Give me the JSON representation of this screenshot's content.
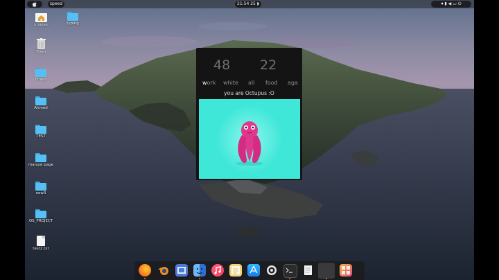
{
  "topbar": {
    "apple_icon": "apple-icon",
    "active_app": "speed",
    "clock": "21:54",
    "indicator": "25"
  },
  "desktop_icons": [
    {
      "label": "ursules",
      "icon": "home-folder-icon"
    },
    {
      "label": "typing",
      "icon": "folder-icon"
    },
    {
      "label": "Trash",
      "icon": "trash-icon"
    },
    {
      "label": "chaos",
      "icon": "folder-icon"
    },
    {
      "label": "Ahmed",
      "icon": "folder-icon"
    },
    {
      "label": "TEST",
      "icon": "folder-icon"
    },
    {
      "label": "manual page",
      "icon": "folder-icon"
    },
    {
      "label": "new3",
      "icon": "folder-icon"
    },
    {
      "label": "OS_PROJECT",
      "icon": "folder-icon"
    },
    {
      "label": "test2.txt",
      "icon": "text-file-icon"
    }
  ],
  "app": {
    "left_number": "48",
    "right_number": "22",
    "typed_prefix": "w",
    "words": [
      {
        "rest": "ork",
        "text": "work"
      },
      {
        "text": "white"
      },
      {
        "text": "all"
      },
      {
        "text": "food"
      },
      {
        "text": "aga"
      }
    ],
    "result": "you are Octupus :O",
    "image": "octopus-illustration"
  },
  "dock": [
    {
      "name": "firefox",
      "icon": "firefox-icon",
      "running": true
    },
    {
      "name": "blender",
      "icon": "blender-icon",
      "running": false
    },
    {
      "name": "screenshot",
      "icon": "screenshot-icon",
      "running": false
    },
    {
      "name": "finder",
      "icon": "finder-icon",
      "running": true
    },
    {
      "name": "music",
      "icon": "music-icon",
      "running": false
    },
    {
      "name": "notes",
      "icon": "notes-icon",
      "running": false
    },
    {
      "name": "app-store",
      "icon": "app-store-icon",
      "running": false
    },
    {
      "name": "settings",
      "icon": "settings-icon",
      "running": false
    },
    {
      "name": "terminal",
      "icon": "terminal-icon",
      "running": true
    },
    {
      "name": "text-editor",
      "icon": "text-editor-icon",
      "running": false
    },
    {
      "name": "running-app",
      "icon": "app-window-icon",
      "running": true
    },
    {
      "name": "launcher",
      "icon": "launcher-icon",
      "running": false
    }
  ],
  "colors": {
    "app_background": "#141414",
    "image_background": "#3ee7d8",
    "octopus": "#e0388f",
    "folder": "#55c0f5",
    "dock_running_dot": "#f07a3a"
  }
}
